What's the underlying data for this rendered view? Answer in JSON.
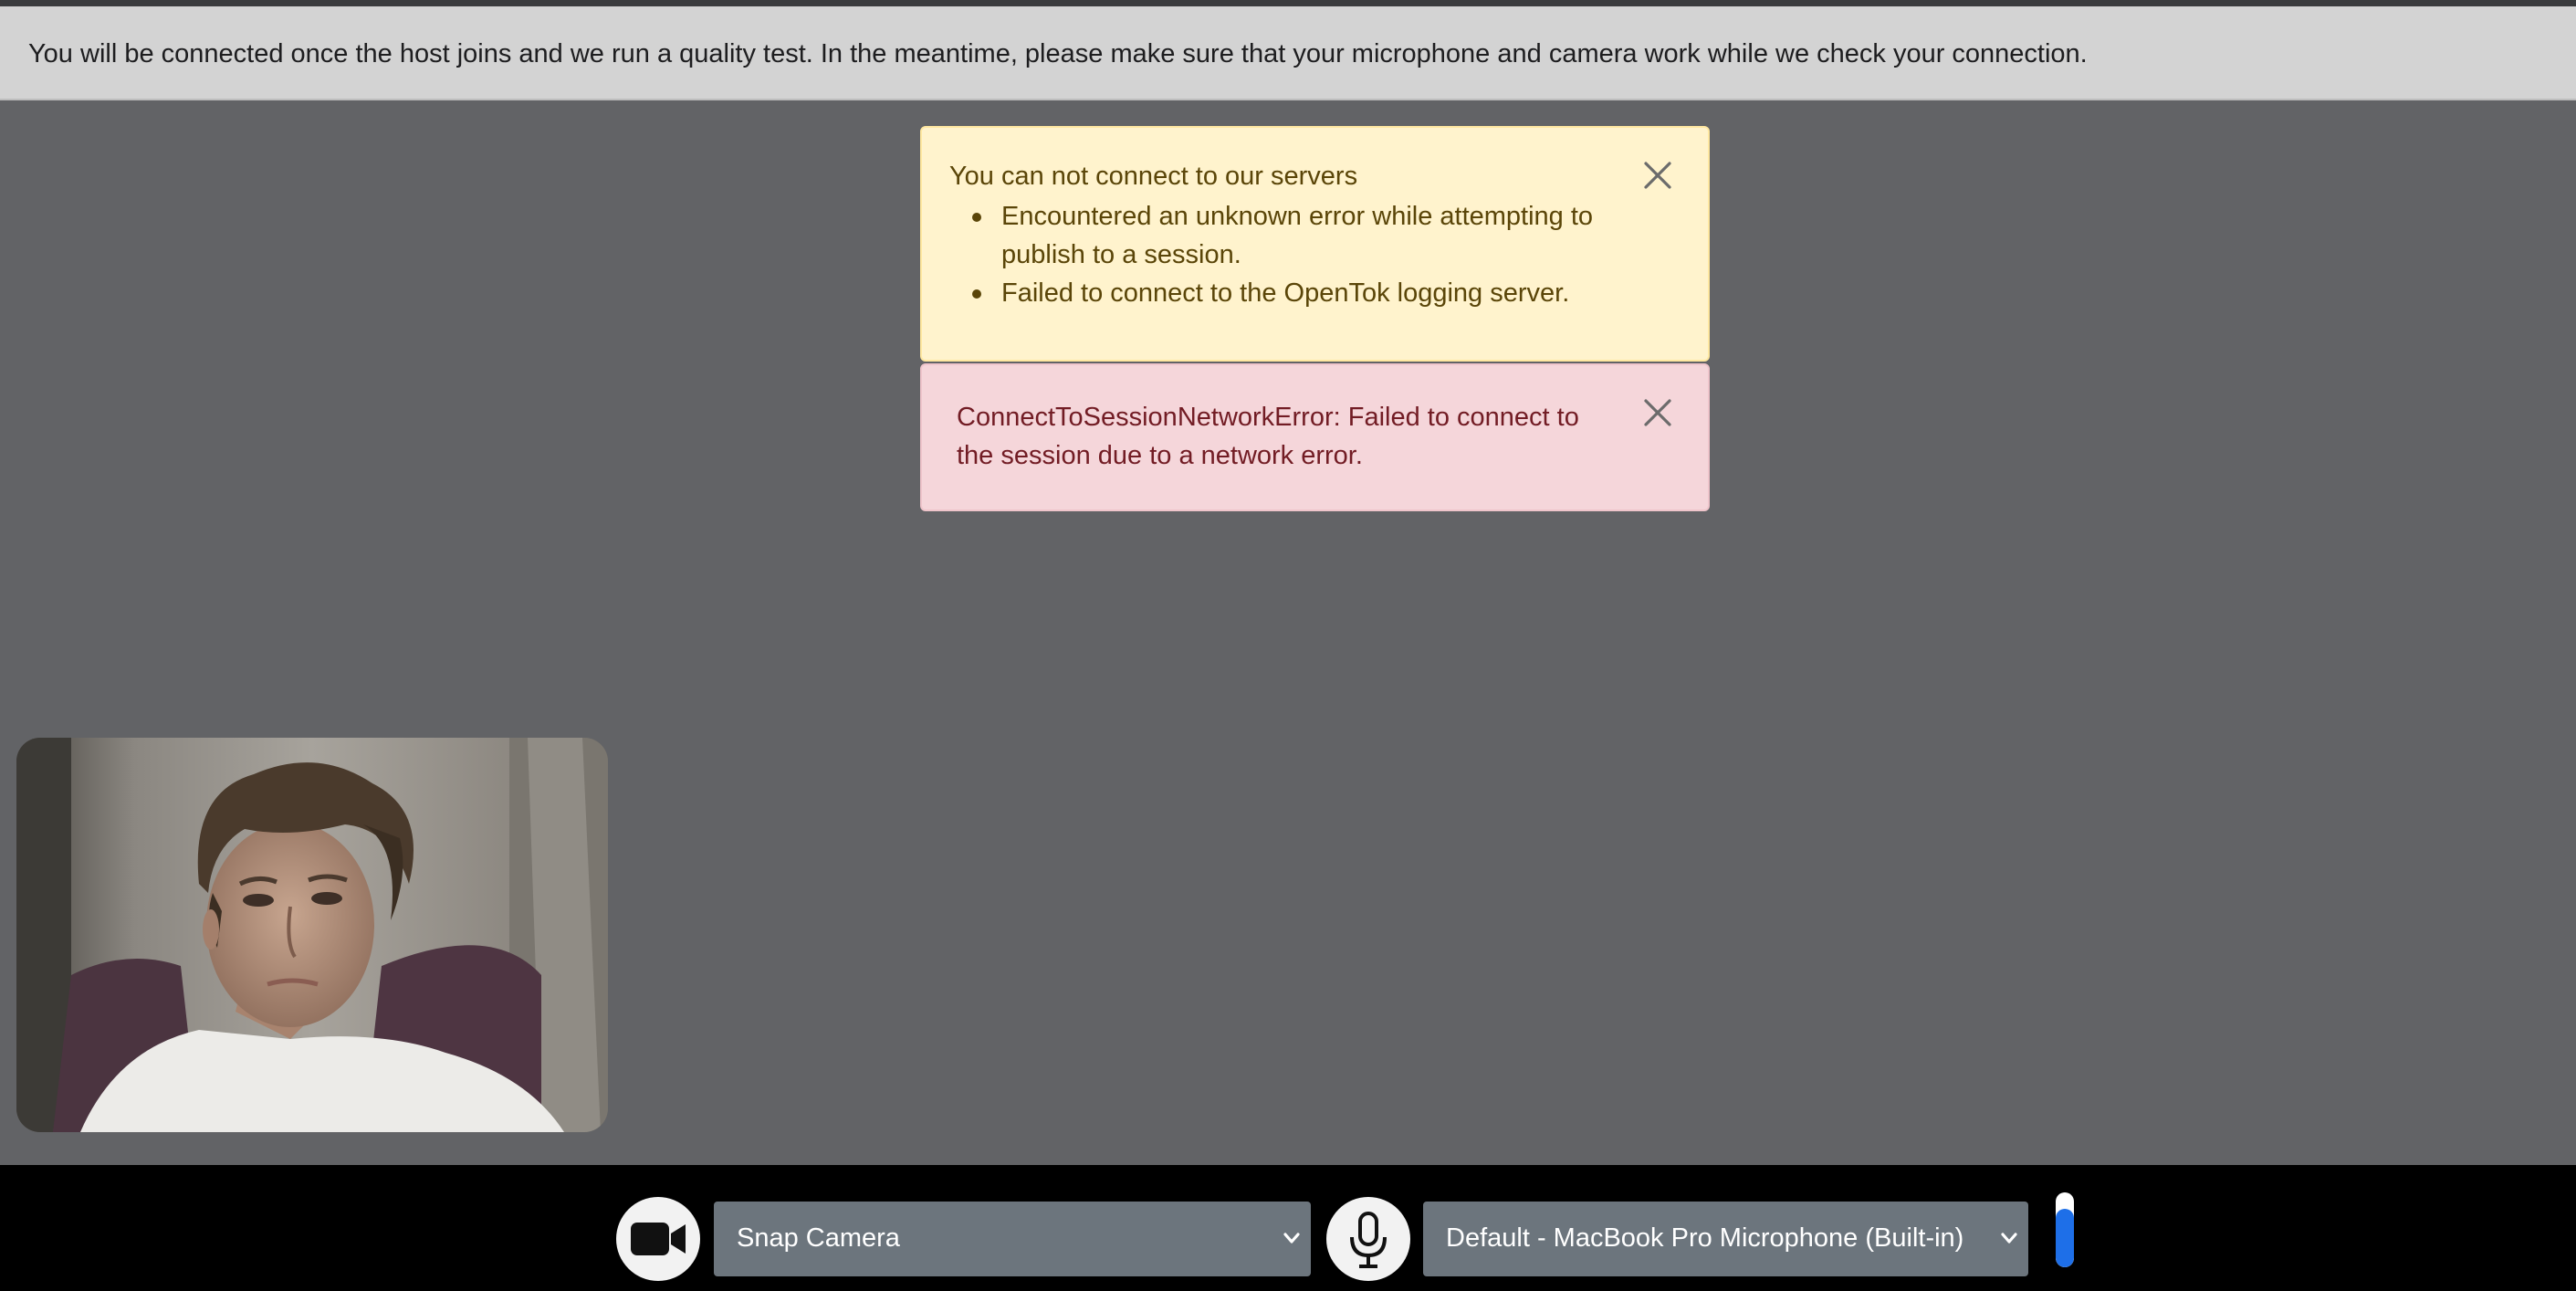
{
  "banner": {
    "text": "You will be connected once the host joins and we run a quality test. In the meantime, please make sure that your microphone and camera work while we check your connection."
  },
  "alerts": {
    "warning": {
      "title": "You can not connect to our servers",
      "items": [
        "Encountered an unknown error while attempting to publish to a session.",
        "Failed to connect to the OpenTok logging server."
      ]
    },
    "error": {
      "message": "ConnectToSessionNetworkError: Failed to connect to the session due to a network error."
    }
  },
  "toolbar": {
    "camera_icon": "video-camera-icon",
    "camera_select": "Snap Camera",
    "mic_icon": "microphone-icon",
    "mic_select": "Default - MacBook Pro Microphone (Built-in)",
    "audio_level_fraction": 0.78
  },
  "colors": {
    "page_background": "#626366",
    "banner_background": "#d3d3d3",
    "warning_background": "#fff3cd",
    "error_background": "#f5d6da",
    "toolbar_background": "#000000",
    "select_background": "#6c757d",
    "level_fill": "#1e6fe8"
  }
}
